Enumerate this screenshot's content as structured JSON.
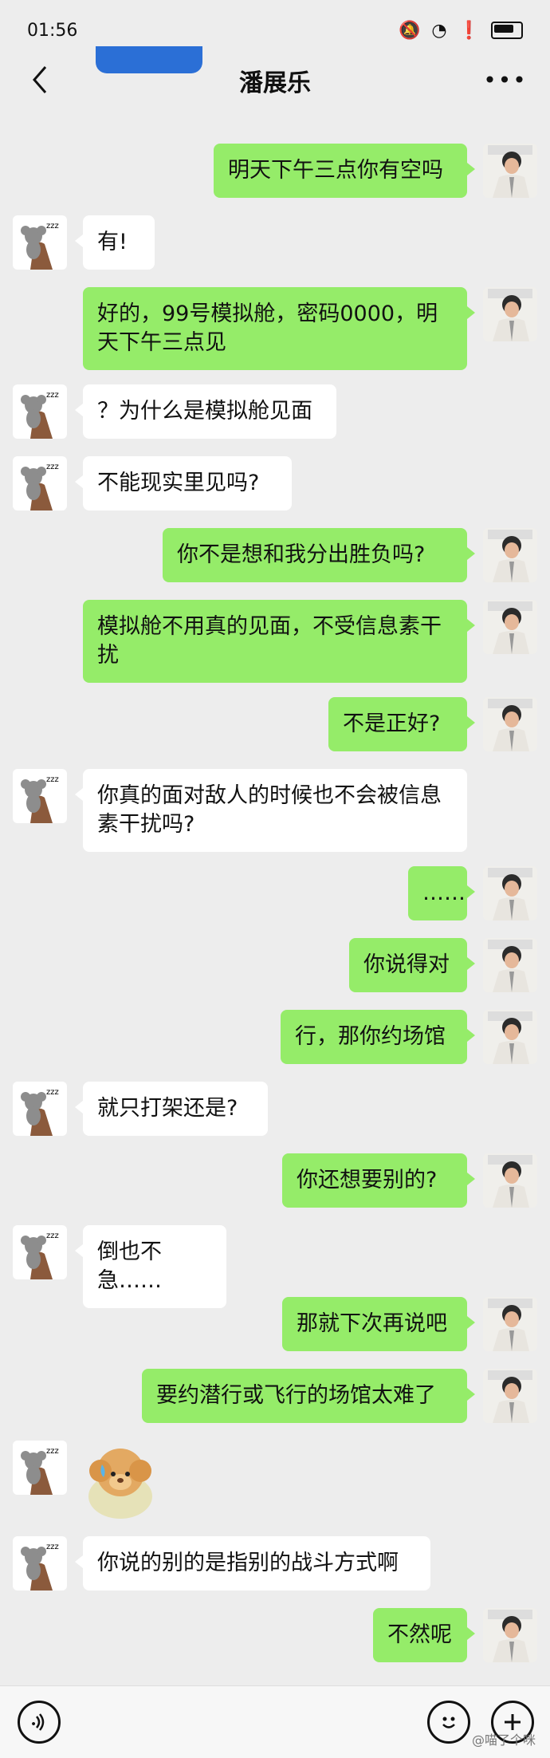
{
  "statusbar": {
    "time": "01:56"
  },
  "header": {
    "title": "潘展乐",
    "more_label": "•••"
  },
  "messages": [
    {
      "side": "right",
      "text": "明天下午三点你有空吗"
    },
    {
      "side": "left",
      "text": "有!"
    },
    {
      "side": "right",
      "text": "好的，99号模拟舱，密码0000，明天下午三点见"
    },
    {
      "side": "left",
      "text": "？为什么是模拟舱见面"
    },
    {
      "side": "left",
      "text": "不能现实里见吗?"
    },
    {
      "side": "right",
      "text": "你不是想和我分出胜负吗?"
    },
    {
      "side": "right",
      "text": "模拟舱不用真的见面，不受信息素干扰"
    },
    {
      "side": "right",
      "text": "不是正好?"
    },
    {
      "side": "left",
      "text": "你真的面对敌人的时候也不会被信息素干扰吗?"
    },
    {
      "side": "right",
      "text": "……"
    },
    {
      "side": "right",
      "text": "你说得对"
    },
    {
      "side": "right",
      "text": "行，那你约场馆"
    },
    {
      "side": "left",
      "text": "就只打架还是?"
    },
    {
      "side": "right",
      "text": "你还想要别的?"
    },
    {
      "side": "left",
      "text": "倒也不急……"
    },
    {
      "side": "right",
      "text": "那就下次再说吧"
    },
    {
      "side": "right",
      "text": "要约潜行或飞行的场馆太难了"
    },
    {
      "side": "left",
      "text": "",
      "sticker": "puppy-sticker"
    },
    {
      "side": "left",
      "text": "你说的别的是指别的战斗方式啊"
    },
    {
      "side": "right",
      "text": "不然呢"
    }
  ],
  "inputbar": {
    "placeholder": ""
  },
  "credit": "@喵了个咪"
}
